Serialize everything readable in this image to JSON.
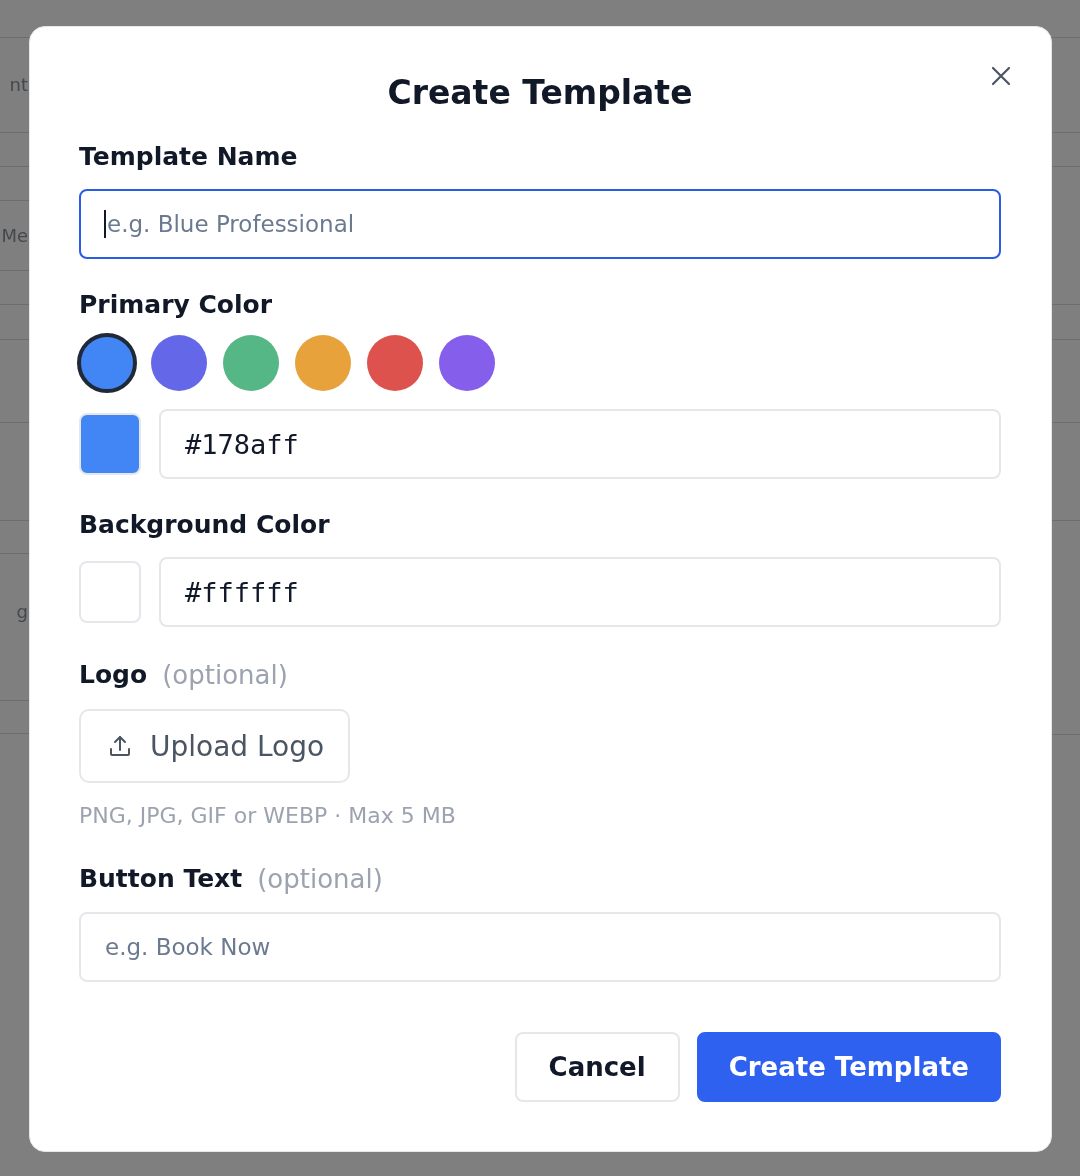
{
  "background": {
    "labels": [
      "nt",
      "Me",
      "g"
    ]
  },
  "dialog": {
    "title": "Create Template",
    "fields": [
      {
        "kind": "text",
        "label": "Template Name",
        "placeholder": "e.g. Blue Professional",
        "focused": true
      },
      {
        "kind": "color",
        "label": "Primary Color",
        "swatches": [
          {
            "color": "#4285f4",
            "selected": true
          },
          {
            "color": "#6468e8",
            "selected": false
          },
          {
            "color": "#55b686",
            "selected": false
          },
          {
            "color": "#e8a23b",
            "selected": false
          },
          {
            "color": "#de524e",
            "selected": false
          },
          {
            "color": "#855fec",
            "selected": false
          }
        ],
        "value": "#178aff"
      },
      {
        "kind": "color",
        "label": "Background Color",
        "value": "#ffffff"
      },
      {
        "kind": "upload",
        "label": "Logo",
        "note": "(optional)",
        "button": "Upload Logo",
        "hint": "PNG, JPG, GIF or WEBP · Max 5 MB"
      },
      {
        "kind": "text",
        "label": "Button Text",
        "note": "(optional)",
        "placeholder": "e.g. Book Now",
        "focused": false
      }
    ],
    "buttons": [
      {
        "label": "Cancel",
        "kind": "secondary"
      },
      {
        "label": "Create Template",
        "kind": "primary"
      }
    ]
  }
}
